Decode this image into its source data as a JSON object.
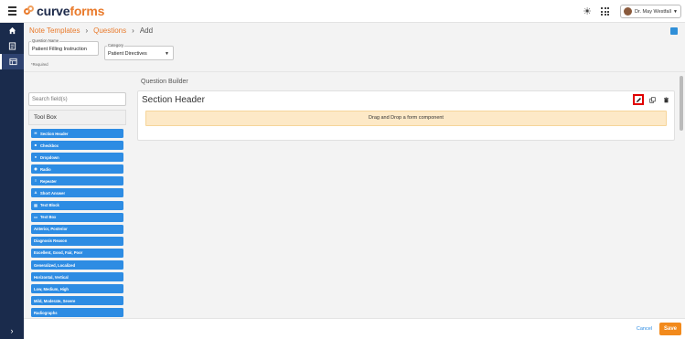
{
  "app": {
    "logo_word_1": "curve",
    "logo_word_2": "forms",
    "user_name": "Dr. May Westfall"
  },
  "breadcrumb": {
    "item1": "Note Templates",
    "item2": "Questions",
    "item3": "Add"
  },
  "form": {
    "question_name_label": "Question Name",
    "question_name_value": "Patient Filling Instruction",
    "category_label": "Category",
    "category_value": "Patient Directives",
    "required_note": "*Required"
  },
  "builder": {
    "title": "Question Builder",
    "section_header_title": "Section Header",
    "dropzone_text": "Drag and Drop a form component"
  },
  "toolbox": {
    "search_placeholder": "Search field(s)",
    "title": "Tool Box",
    "items": [
      {
        "label": "Section Header",
        "icon": "H"
      },
      {
        "label": "Checkbox",
        "icon": "■"
      },
      {
        "label": "Dropdown",
        "icon": "●"
      },
      {
        "label": "Radio",
        "icon": "◉"
      },
      {
        "label": "Repeater",
        "icon": "≡"
      },
      {
        "label": "Short Answer",
        "icon": "A"
      },
      {
        "label": "Text Block",
        "icon": "▤"
      },
      {
        "label": "Text Box",
        "icon": "▭"
      },
      {
        "label": "Anterior, Posterior",
        "icon": ""
      },
      {
        "label": "Diagnosis Reason",
        "icon": ""
      },
      {
        "label": "Excellent, Good, Fair, Poor",
        "icon": ""
      },
      {
        "label": "Generalized, Localized",
        "icon": ""
      },
      {
        "label": "Horizontal, Vertical",
        "icon": ""
      },
      {
        "label": "Low, Medium, High",
        "icon": ""
      },
      {
        "label": "Mild, Moderate, Severe",
        "icon": ""
      },
      {
        "label": "Radiographs",
        "icon": ""
      }
    ]
  },
  "footer": {
    "cancel_label": "Cancel",
    "save_label": "Save"
  },
  "colors": {
    "accent": "#e97a2b",
    "sidebar": "#1a2b4c",
    "tool_blue": "#2d8ce3",
    "save_orange": "#f28a1c",
    "dropzone": "#fde9c7"
  }
}
